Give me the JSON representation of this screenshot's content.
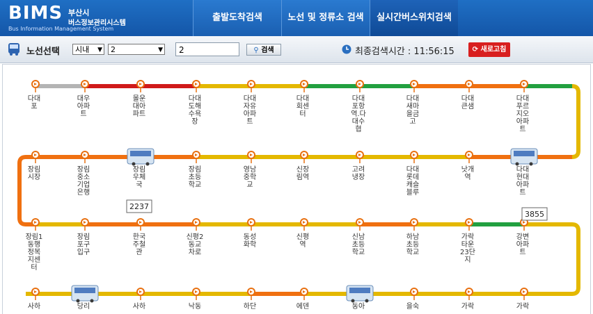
{
  "header": {
    "logo": "BIMS",
    "logo_sub": "Bus Information Management System",
    "city": "부산시",
    "system": "버스정보관리시스템",
    "tabs": [
      {
        "label": "출발도착검색",
        "active": false
      },
      {
        "label": "노선 및 정류소 검색",
        "active": false
      },
      {
        "label": "실시간버스위치검색",
        "active": true
      }
    ]
  },
  "toolbar": {
    "title": "노선선택",
    "region": "시내",
    "route_select": "2",
    "route_input": "2",
    "search_label": "검색",
    "last_search_label": "최종검색시간 :",
    "last_search_time": "11:56:15",
    "refresh_label": "새로고침"
  },
  "route": {
    "colors": {
      "gray": "#b4b4b4",
      "red": "#d01a1a",
      "orange": "#f07010",
      "yellow": "#e4b800",
      "green": "#22a040"
    },
    "rows": [
      {
        "segments": [
          "gray",
          "red",
          "red",
          "yellow",
          "yellow",
          "green",
          "green",
          "orange",
          "orange",
          "green",
          "yellow"
        ],
        "stops": [
          {
            "name": "다대포",
            "lines": [
              "다대",
              "포"
            ]
          },
          {
            "name": "대우아파트",
            "lines": [
              "대우",
              "아파",
              "트"
            ]
          },
          {
            "name": "몰운대아파트",
            "lines": [
              "몰운",
              "대아",
              "파트"
            ]
          },
          {
            "name": "다대도해수욕장",
            "lines": [
              "다대",
              "도해",
              "수욕",
              "장"
            ]
          },
          {
            "name": "다대자유아파트",
            "lines": [
              "다대",
              "자유",
              "아파",
              "트"
            ]
          },
          {
            "name": "다대회센터",
            "lines": [
              "다대",
              "회센",
              "터"
            ]
          },
          {
            "name": "다대포항역.다대수협",
            "lines": [
              "다대",
              "포항",
              "역.다",
              "대수",
              "협"
            ]
          },
          {
            "name": "다대새마을금고",
            "lines": [
              "다대",
              "새마",
              "을금",
              "고"
            ]
          },
          {
            "name": "다대큰샘",
            "lines": [
              "다대",
              "큰샘"
            ]
          },
          {
            "name": "다대푸르지오아파트",
            "lines": [
              "다대",
              "푸르",
              "지오",
              "아파",
              "트"
            ]
          }
        ]
      },
      {
        "segments": [
          "orange",
          "orange",
          "orange",
          "orange",
          "yellow",
          "yellow",
          "yellow",
          "yellow",
          "yellow",
          "orange",
          "orange"
        ],
        "stops": [
          {
            "name": "장림시장",
            "lines": [
              "장림",
              "시장"
            ]
          },
          {
            "name": "장림중소기업은행",
            "lines": [
              "장림",
              "중소",
              "기업",
              "은행"
            ]
          },
          {
            "name": "장림우체국",
            "lines": [
              "장림",
              "우체",
              "국"
            ]
          },
          {
            "name": "장림초등학교",
            "lines": [
              "장림",
              "초등",
              "학교"
            ]
          },
          {
            "name": "영남중학교",
            "lines": [
              "영남",
              "중학",
              "교"
            ]
          },
          {
            "name": "신장림역",
            "lines": [
              "신장",
              "림역"
            ]
          },
          {
            "name": "고려냉장",
            "lines": [
              "고려",
              "냉장"
            ]
          },
          {
            "name": "다대롯데캐슬블루",
            "lines": [
              "다대",
              "롯데",
              "캐슬",
              "블루"
            ]
          },
          {
            "name": "낫개역",
            "lines": [
              "낫개",
              "역"
            ]
          },
          {
            "name": "다대현대아파트",
            "lines": [
              "다대",
              "현대",
              "아파",
              "트"
            ]
          }
        ]
      },
      {
        "segments": [
          "orange",
          "yellow",
          "orange",
          "orange",
          "yellow",
          "yellow",
          "yellow",
          "orange",
          "yellow",
          "green",
          "yellow"
        ],
        "stops": [
          {
            "name": "장림1동행정복지센터",
            "lines": [
              "장림1",
              "동행",
              "정복",
              "지센",
              "터"
            ]
          },
          {
            "name": "장림포구입구",
            "lines": [
              "장림",
              "포구",
              "입구"
            ]
          },
          {
            "name": "한국주철관",
            "lines": [
              "한국",
              "주철",
              "관"
            ]
          },
          {
            "name": "신평2동교차로",
            "lines": [
              "신평2",
              "동교",
              "차로"
            ]
          },
          {
            "name": "동성화학",
            "lines": [
              "동성",
              "화학"
            ]
          },
          {
            "name": "신평역",
            "lines": [
              "신평",
              "역"
            ]
          },
          {
            "name": "신남초등학교",
            "lines": [
              "신남",
              "초등",
              "학교"
            ]
          },
          {
            "name": "하남초등학교",
            "lines": [
              "하남",
              "초등",
              "학교"
            ]
          },
          {
            "name": "가락타운23단지",
            "lines": [
              "가락",
              "타운",
              "23단",
              "지"
            ]
          },
          {
            "name": "강변아파트",
            "lines": [
              "강변",
              "아파",
              "트"
            ]
          }
        ]
      },
      {
        "segments": [
          "yellow",
          "yellow",
          "yellow",
          "yellow",
          "yellow",
          "orange",
          "yellow",
          "yellow",
          "yellow",
          "yellow",
          "yellow"
        ],
        "stops": [
          {
            "name": "사하",
            "lines": [
              "사하"
            ]
          },
          {
            "name": "당리",
            "lines": [
              "당리"
            ]
          },
          {
            "name": "사하",
            "lines": [
              "사하"
            ]
          },
          {
            "name": "낙동",
            "lines": [
              "낙동"
            ]
          },
          {
            "name": "하단",
            "lines": [
              "하단"
            ]
          },
          {
            "name": "에덴",
            "lines": [
              "에덴"
            ]
          },
          {
            "name": "동아",
            "lines": [
              "동아"
            ]
          },
          {
            "name": "을숙",
            "lines": [
              "을숙"
            ]
          },
          {
            "name": "가락",
            "lines": [
              "가락"
            ]
          },
          {
            "name": "가락",
            "lines": [
              "가락"
            ]
          }
        ]
      }
    ],
    "turn_colors": [
      "yellow",
      "orange",
      "yellow"
    ],
    "buses": [
      {
        "row": 1,
        "stop": 2,
        "number": "2237"
      },
      {
        "row": 1,
        "stop": 9,
        "number": "3855"
      },
      {
        "row": 3,
        "stop": 1,
        "number": ""
      },
      {
        "row": 3,
        "stop": 6,
        "number": ""
      }
    ]
  }
}
